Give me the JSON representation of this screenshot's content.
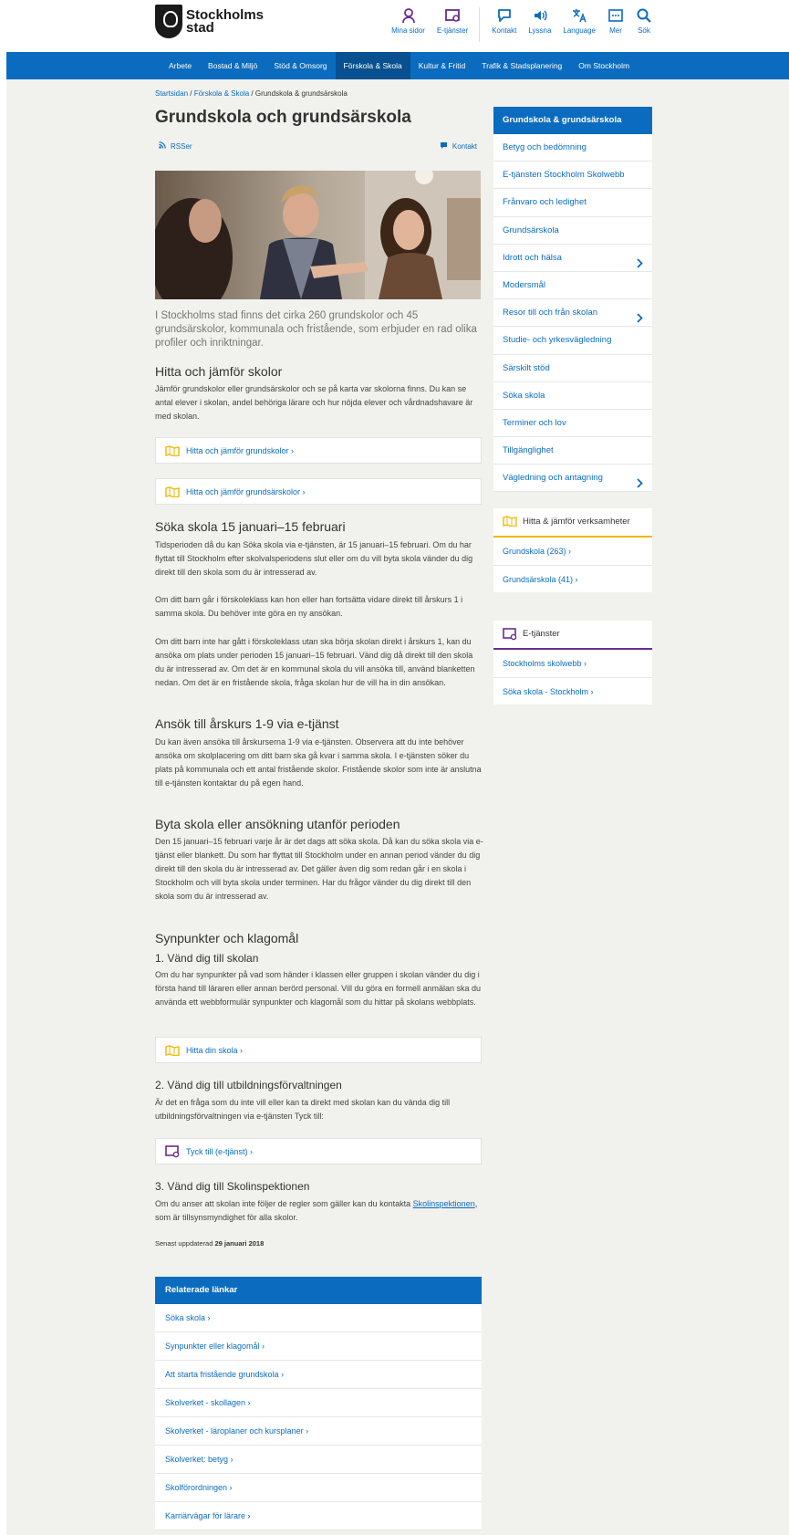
{
  "header": {
    "logo_line1": "Stockholms",
    "logo_line2": "stad",
    "utility": [
      {
        "label": "Mina sidor",
        "icon": "person-icon"
      },
      {
        "label": "E-tjänster",
        "icon": "eservice-icon"
      },
      {
        "label": "Kontakt",
        "icon": "chat-icon"
      },
      {
        "label": "Lyssna",
        "icon": "speaker-icon"
      },
      {
        "label": "Language",
        "icon": "language-icon"
      },
      {
        "label": "Mer",
        "icon": "more-icon"
      },
      {
        "label": "Sök",
        "icon": "search-icon"
      }
    ]
  },
  "nav": {
    "items": [
      "Arbete",
      "Bostad & Miljö",
      "Stöd & Omsorg",
      "Förskola & Skola",
      "Kultur & Fritid",
      "Trafik & Stadsplanering",
      "Om Stockholm"
    ],
    "active": "Förskola & Skola"
  },
  "breadcrumb": {
    "home": "Startsidan",
    "sep": " / ",
    "parent": "Förskola & Skola",
    "current": "Grundskola & grundsärskola"
  },
  "page": {
    "title": "Grundskola och grundsärskola",
    "rss": "RSSer",
    "contact": "Kontakt",
    "lead": "I Stockholms stad finns det cirka 260 grundskolor och 45 grundsärskolor, kommunala och fristående, som erbjuder en rad olika profiler och inriktningar."
  },
  "sections": {
    "find_heading": "Hitta och jämför skolor",
    "find_text": "Jämför grundskolor eller grundsärskolor och se på karta var skolorna finns. Du kan se antal elever i skolan, andel behöriga lärare och hur nöjda elever och vårdnadshavare är med skolan.",
    "find_link1": "Hitta och jämför grundskolor ›",
    "find_link2": "Hitta och jämför grundsärskolor ›",
    "apply_heading": "Söka skola 15 januari–15 februari",
    "apply_p1": "Tidsperioden då du kan Söka skola via e-tjänsten, är 15 januari–15 februari. Om du har flyttat till Stockholm efter skolvalsperiodens slut eller om du vill byta skola vänder du dig direkt till den skola som du är intresserad av.",
    "apply_p2": "Om ditt barn går i förskoleklass kan hon eller han fortsätta vidare direkt till årskurs 1 i samma skola. Du behöver inte göra en ny ansökan.",
    "apply_p3": "Om ditt barn inte har gått i förskoleklass utan ska börja skolan direkt i årskurs 1, kan du ansöka om plats under perioden 15 januari–15 februari. Vänd dig då direkt till den skola du är intresserad av. Om det är en kommunal skola du vill ansöka till, använd blanketten nedan. Om det är en fristående skola, fråga skolan hur de vill ha in din ansökan.",
    "grades_heading": "Ansök till årskurs 1-9 via e-tjänst",
    "grades_text": "Du kan även ansöka till årskurserna 1-9 via e-tjänsten. Observera att du inte behöver ansöka om skolplacering om ditt barn ska gå kvar i samma skola. I e-tjänsten söker du plats på kommunala och ett antal fristående skolor. Fristående skolor som inte är anslutna till e-tjänsten kontaktar du på egen hand.",
    "switch_heading": "Byta skola eller ansökning utanför perioden",
    "switch_text": "Den 15 januari–15 februari varje år är det dags att söka skola. Då kan du söka skola via e-tjänst eller blankett. Du som har flyttat till Stockholm under en annan period vänder du dig direkt till den skola du är intresserad av. Det gäller även dig som redan går i en skola i Stockholm och vill byta skola under terminen. Har du frågor vänder du dig direkt till den skola som du är intresserad av.",
    "complaints_heading": "Synpunkter och klagomål",
    "step1_heading": "1. Vänd dig till skolan",
    "step1_text": "Om du har synpunkter på vad som händer i klassen eller gruppen i skolan vänder du dig i första hand till läraren eller annan berörd personal. Vill du göra en formell anmälan ska du använda ett webbformulär synpunkter och klagomål som du hittar på skolans webbplats.",
    "step1_link": "Hitta din skola ›",
    "step2_heading": "2. Vänd dig till utbildningsförvaltningen",
    "step2_text": "Är det en fråga som du inte vill eller kan ta direkt med skolan kan du vända dig till utbildningsförvaltningen via e-tjänsten Tyck till:",
    "step2_link": "Tyck till (e-tjänst) ›",
    "step3_heading": "3. Vänd dig till Skolinspektionen",
    "step3_text_a": "Om du anser att skolan inte följer de regler som gäller kan du kontakta ",
    "step3_link": "Skolinspektionen",
    "step3_text_b": ", som är tillsynsmyndighet för alla skolor.",
    "updated_label": "Senast uppdaterad",
    "updated_date": "29 januari 2018"
  },
  "related": {
    "heading": "Relaterade länkar",
    "items": [
      "Söka skola ›",
      "Synpunkter eller klagomål ›",
      "Att starta fristående grundskola ›",
      "Skolverket - skollagen ›",
      "Skolverket - läroplaner och kursplaner ›",
      "Skolverket: betyg ›",
      "Skolförordningen ›",
      "Karriärvägar för lärare ›"
    ]
  },
  "sidebar": {
    "heading": "Grundskola & grundsärskola",
    "items": [
      {
        "label": "Betyg och bedömning",
        "chevron": false
      },
      {
        "label": "E-tjänsten Stockholm Skolwebb",
        "chevron": false
      },
      {
        "label": "Frånvaro och ledighet",
        "chevron": false
      },
      {
        "label": "Grundsärskola",
        "chevron": false
      },
      {
        "label": "Idrott och hälsa",
        "chevron": true
      },
      {
        "label": "Modersmål",
        "chevron": false
      },
      {
        "label": "Resor till och från skolan",
        "chevron": true
      },
      {
        "label": "Studie- och yrkesvägledning",
        "chevron": false
      },
      {
        "label": "Särskilt stöd",
        "chevron": false
      },
      {
        "label": "Söka skola",
        "chevron": false
      },
      {
        "label": "Terminer och lov",
        "chevron": false
      },
      {
        "label": "Tillgänglighet",
        "chevron": false
      },
      {
        "label": "Vägledning och antagning",
        "chevron": true
      }
    ],
    "compare_heading": "Hitta & jämför verksamheter",
    "compare_items": [
      "Grundskola (263) ›",
      "Grundsärskola (41) ›"
    ],
    "eservice_heading": "E-tjänster",
    "eservice_items": [
      "Stockholms skolwebb ›",
      "Söka skola - Stockholm ›"
    ]
  },
  "colors": {
    "brand_blue": "#0b6cbf",
    "active_nav": "#08508f",
    "compare_accent": "#f2b705",
    "eservice_accent": "#6b2c91",
    "background": "#f1f1ee"
  }
}
